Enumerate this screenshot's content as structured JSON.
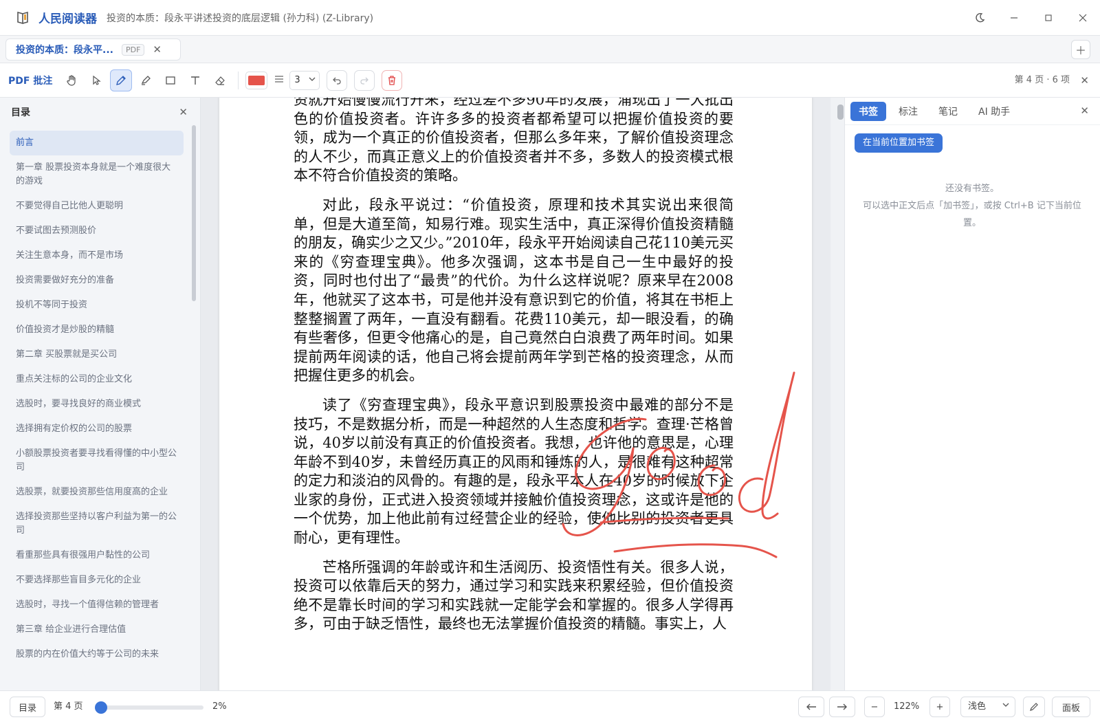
{
  "window": {
    "app_name": "人民阅读器",
    "doc_title": "投资的本质：段永平讲述投资的底层逻辑 (孙力科) (Z-Library)",
    "theme_toggle_icon": "moon-icon"
  },
  "tabs": [
    {
      "title": "投资的本质：段永平...",
      "badge": "PDF"
    }
  ],
  "toolbar": {
    "label": "PDF 批注",
    "tools": [
      "hand-icon",
      "pointer-icon",
      "pen-icon",
      "highlighter-icon",
      "rectangle-icon",
      "text-icon",
      "eraser-icon"
    ],
    "active_tool": "pen-icon",
    "color": "#e5544b",
    "stroke_size": "3",
    "page_info": "第 4 页 · 6 项"
  },
  "toc": {
    "title": "目录",
    "items": [
      "前言",
      "第一章 股票投资本身就是一个难度很大的游戏",
      "不要觉得自己比他人更聪明",
      "不要试图去预测股价",
      "关注生意本身，而不是市场",
      "投资需要做好充分的准备",
      "投机不等同于投资",
      "价值投资才是炒股的精髓",
      "第二章 买股票就是买公司",
      "重点关注标的公司的企业文化",
      "选股时，要寻找良好的商业模式",
      "选择拥有定价权的公司的股票",
      "小额股票投资者要寻找看得懂的中小型公司",
      "选股票，就要投资那些信用度高的企业",
      "选择投资那些坚持以客户利益为第一的公司",
      "看重那些具有很强用户黏性的公司",
      "不要选择那些盲目多元化的企业",
      "选股时，寻找一个值得信赖的管理者",
      "第三章 给企业进行合理估值",
      "股票的内在价值大约等于公司的未来"
    ]
  },
  "document": {
    "paragraphs": [
      {
        "indent": false,
        "text": "资就开始慢慢流行开来，经过差不多90年的发展，涌现出了一大批出色的价值投资者。许许多多的投资者都希望可以把握价值投资的要领，成为一个真正的价值投资者，但那么多年来，了解价值投资理念的人不少，而真正意义上的价值投资者并不多，多数人的投资模式根本不符合价值投资的策略。"
      },
      {
        "indent": true,
        "text": "对此，段永平说过：“价值投资，原理和技术其实说出来很简单，但是大道至简，知易行难。现实生活中，真正深得价值投资精髓的朋友，确实少之又少。”2010年，段永平开始阅读自己花110美元买来的《穷查理宝典》。他多次强调，这本书是自己一生中最好的投资，同时也付出了“最贵”的代价。为什么这样说呢？原来早在2008年，他就买了这本书，可是他并没有意识到它的价值，将其在书柜上整整搁置了两年，一直没有翻看。花费110美元，却一眼没看，的确有些奢侈，但更令他痛心的是，自己竟然白白浪费了两年时间。如果提前两年阅读的话，他自己将会提前两年学到芒格的投资理念，从而把握住更多的机会。"
      },
      {
        "indent": true,
        "text": "读了《穷查理宝典》，段永平意识到股票投资中最难的部分不是技巧，不是数据分析，而是一种超然的人生态度和哲学。查理·芒格曾说，40岁以前没有真正的价值投资者。我想，也许他的意思是，心理年龄不到40岁，未曾经历真正的风雨和锤炼的人，是很难有这种超常的定力和淡泊的风骨的。有趣的是，段永平本人在40岁的时候放下企业家的身份，正式进入投资领域并接触价值投资理念，这或许是他的一个优势，加上他此前有过经营企业的经验，使他比别的投资者更具耐心，更有理性。"
      },
      {
        "indent": true,
        "text": "芒格所强调的年龄或许和生活阅历、投资悟性有关。很多人说，投资可以依靠后天的努力，通过学习和实践来积累经验，但价值投资绝不是靠长时间的学习和实践就一定能学会和掌握的。很多人学得再多，可由于缺乏悟性，最终也无法掌握价值投资的精髓。事实上，人"
      }
    ],
    "annotation_word": "Good"
  },
  "right_panel": {
    "tabs": [
      "书签",
      "标注",
      "笔记",
      "AI 助手"
    ],
    "active_tab": "书签",
    "add_bookmark_label": "在当前位置加书签",
    "empty_line1": "还没有书签。",
    "empty_line2": "可以选中正文后点「加书签」，或按 Ctrl+B 记下当前位置。"
  },
  "bottom": {
    "toc_button": "目录",
    "page_label": "第 4 页",
    "progress_percent": 2,
    "progress_text": "2%",
    "zoom_text": "122%",
    "theme_select": "浅色",
    "panel_button": "面板"
  }
}
